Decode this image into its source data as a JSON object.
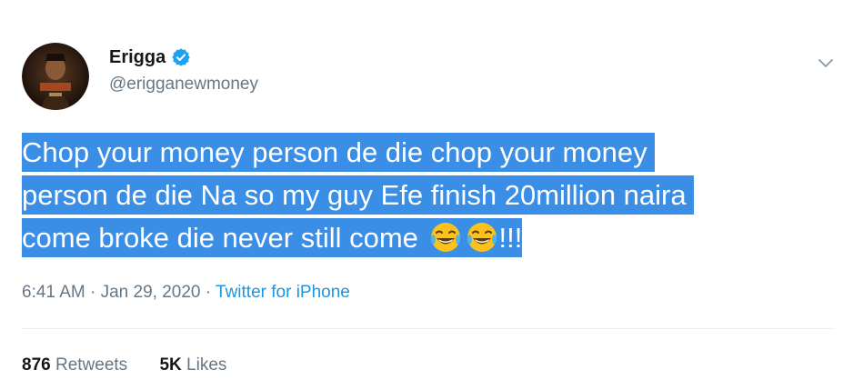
{
  "author": {
    "display_name": "Erigga",
    "handle": "@erigganewmoney",
    "verified": true,
    "verified_color": "#1da1f2"
  },
  "tweet": {
    "line1": "Chop your money person de die chop your money",
    "line2": "person de die Na so my guy Efe finish 20million naira",
    "line3": "come broke die never still come",
    "emoji_name": "face-with-tears-of-joy",
    "trailing": "!!!",
    "highlight_color": "#3a8ee6"
  },
  "meta": {
    "time": "6:41 AM",
    "separator": "·",
    "date": "Jan 29, 2020",
    "source": "Twitter for iPhone"
  },
  "stats": {
    "retweets_count": "876",
    "retweets_label": "Retweets",
    "likes_count": "5K",
    "likes_label": "Likes"
  },
  "icons": {
    "menu": "chevron-down-icon"
  }
}
